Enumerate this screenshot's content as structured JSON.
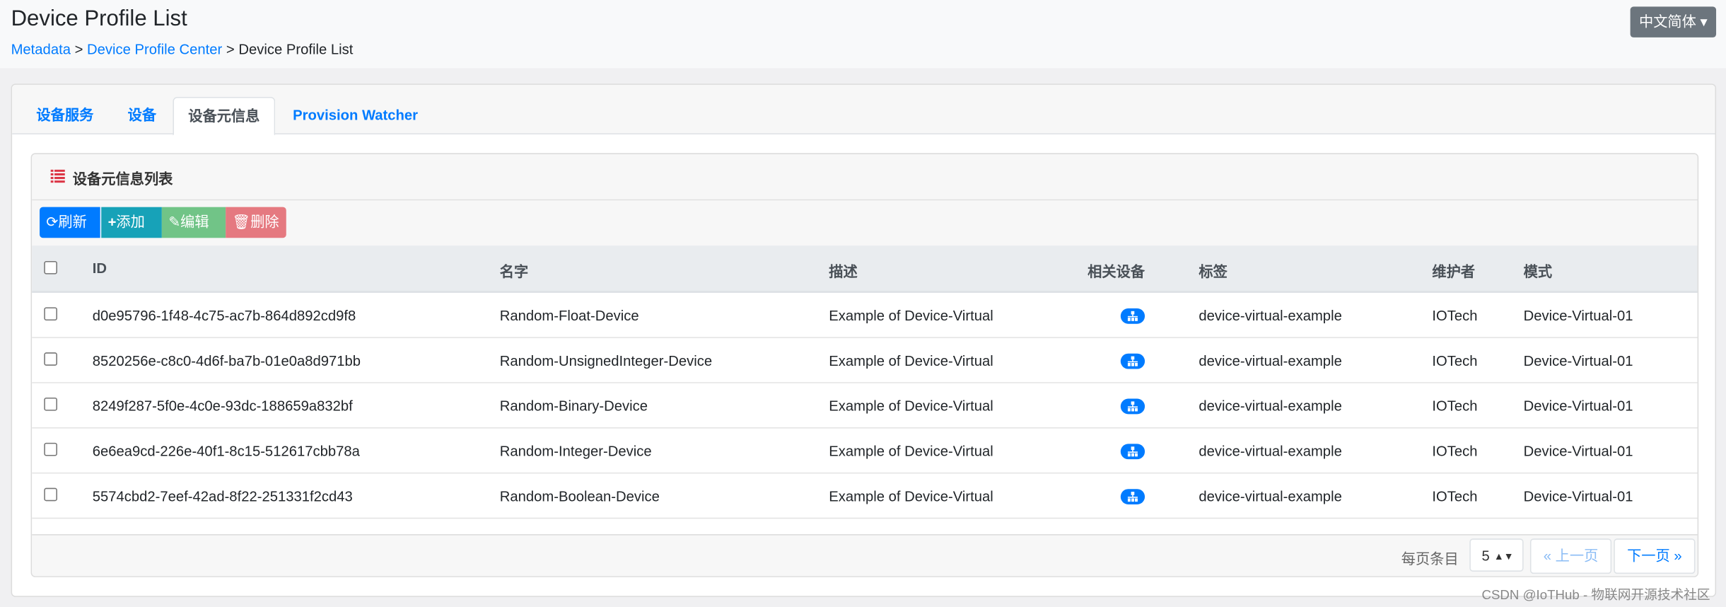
{
  "header": {
    "title": "Device Profile List",
    "breadcrumb": [
      "Metadata",
      "Device Profile Center",
      "Device Profile List"
    ],
    "separator": ">",
    "language": "中文简体 ▾"
  },
  "tabs": [
    {
      "label": "设备服务"
    },
    {
      "label": "设备"
    },
    {
      "label": "设备元信息",
      "active": true
    },
    {
      "label": "Provision Watcher"
    }
  ],
  "panel": {
    "title": "设备元信息列表",
    "icon": "list-icon"
  },
  "toolbar": {
    "refresh": "刷新",
    "add": "添加",
    "edit": "编辑",
    "delete": "删除",
    "colors": {
      "refresh": "#007bff",
      "add": "#17a2b8",
      "edit": "#71c487",
      "delete": "#e57980"
    }
  },
  "table": {
    "columns": [
      "ID",
      "名字",
      "描述",
      "相关设备",
      "标签",
      "维护者",
      "模式"
    ],
    "rows": [
      {
        "id": "d0e95796-1f48-4c75-ac7b-864d892cd9f8",
        "name": "Random-Float-Device",
        "desc": "Example of Device-Virtual",
        "labels": "device-virtual-example",
        "maintainer": "IOTech",
        "model": "Device-Virtual-01"
      },
      {
        "id": "8520256e-c8c0-4d6f-ba7b-01e0a8d971bb",
        "name": "Random-UnsignedInteger-Device",
        "desc": "Example of Device-Virtual",
        "labels": "device-virtual-example",
        "maintainer": "IOTech",
        "model": "Device-Virtual-01"
      },
      {
        "id": "8249f287-5f0e-4c0e-93dc-188659a832bf",
        "name": "Random-Binary-Device",
        "desc": "Example of Device-Virtual",
        "labels": "device-virtual-example",
        "maintainer": "IOTech",
        "model": "Device-Virtual-01"
      },
      {
        "id": "6e6ea9cd-226e-40f1-8c15-512617cbb78a",
        "name": "Random-Integer-Device",
        "desc": "Example of Device-Virtual",
        "labels": "device-virtual-example",
        "maintainer": "IOTech",
        "model": "Device-Virtual-01"
      },
      {
        "id": "5574cbd2-7eef-42ad-8f22-251331f2cd43",
        "name": "Random-Boolean-Device",
        "desc": "Example of Device-Virtual",
        "labels": "device-virtual-example",
        "maintainer": "IOTech",
        "model": "Device-Virtual-01"
      }
    ]
  },
  "pagination": {
    "per_page_label": "每页条目",
    "per_page": "5",
    "prev": "« 上一页",
    "next": "下一页 »"
  },
  "watermark": "CSDN @IoTHub - 物联网开源技术社区"
}
